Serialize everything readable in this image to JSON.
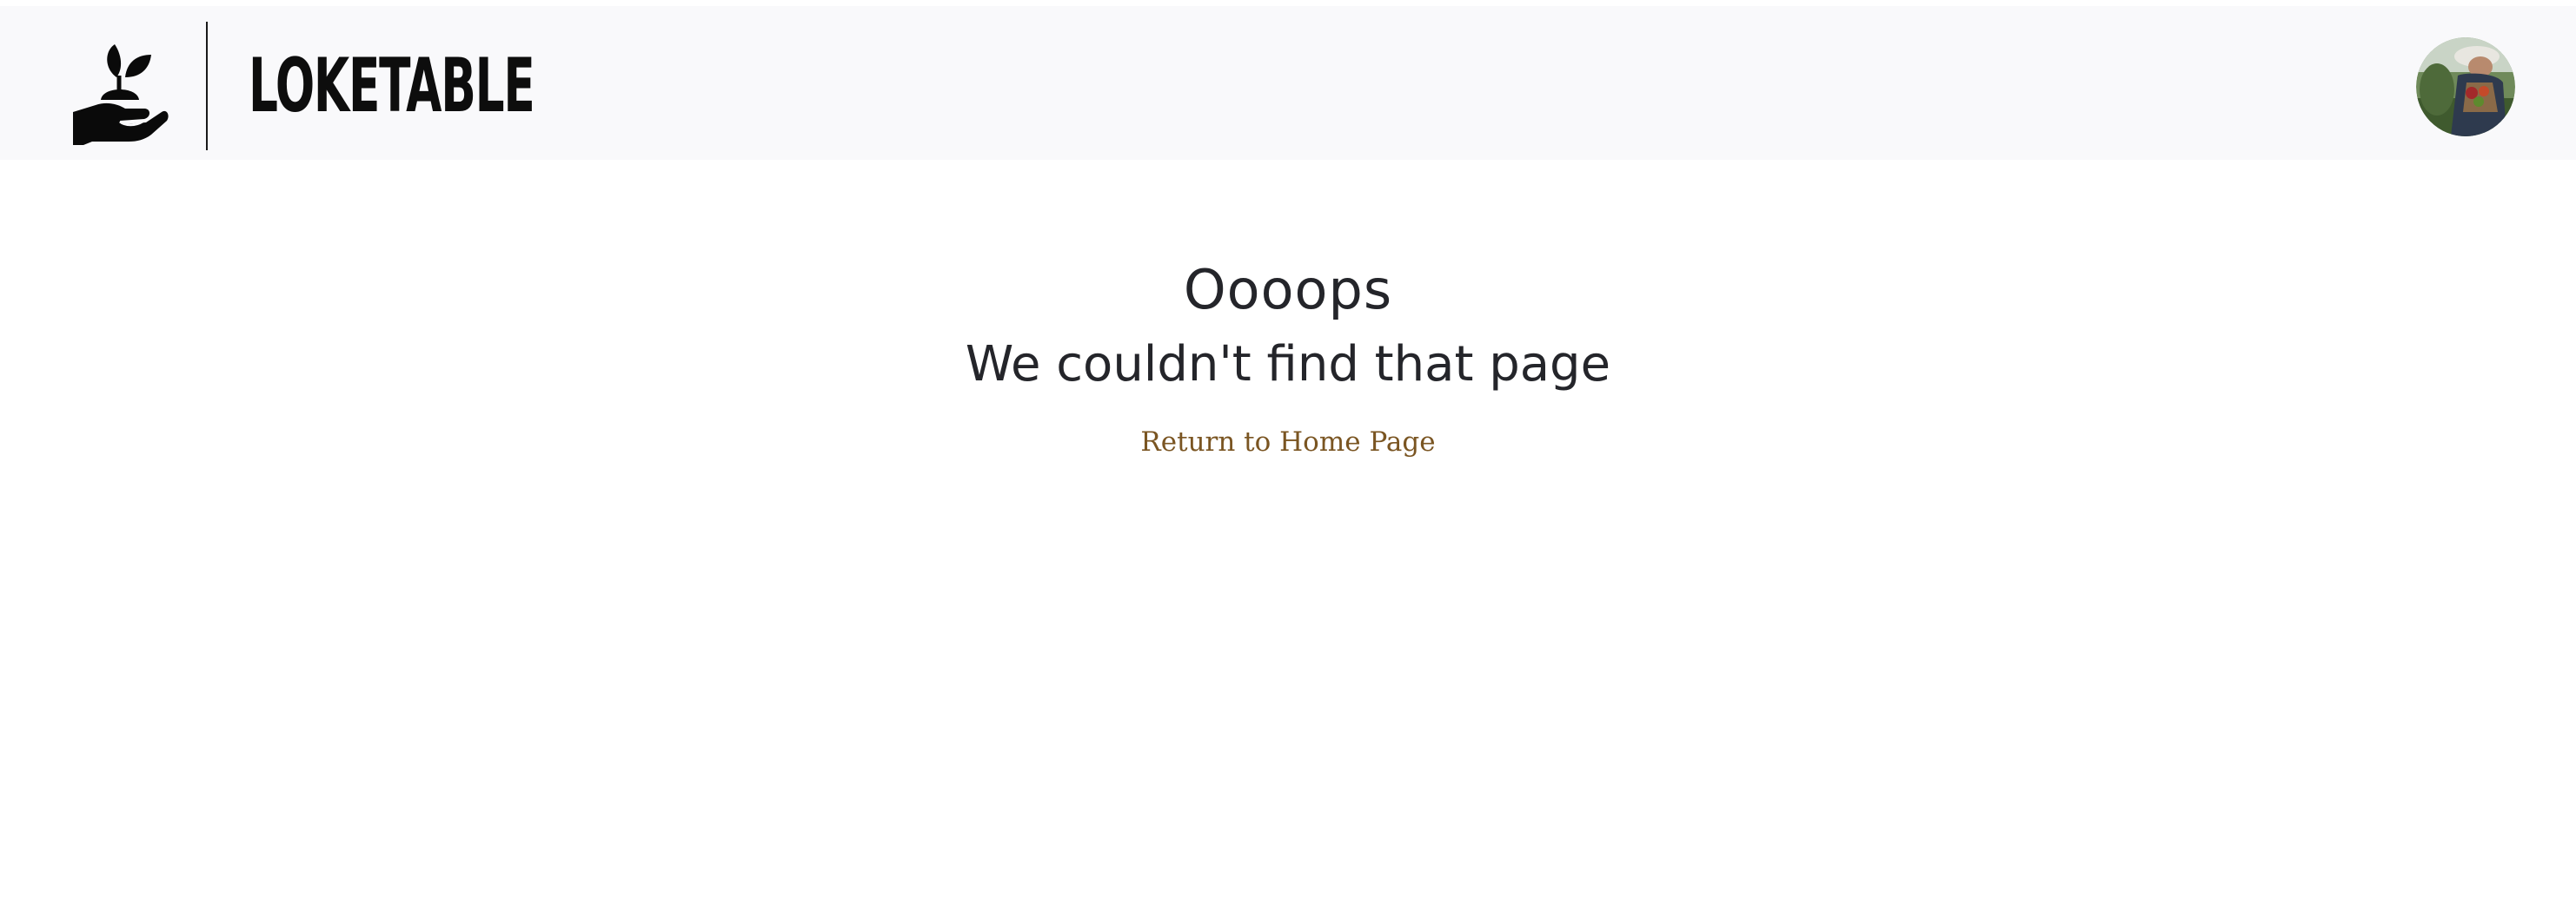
{
  "header": {
    "logo_icon": "hand-holding-seedling-icon",
    "brand_name": "LOKETABLE",
    "avatar_icon": "user-avatar-photo"
  },
  "main": {
    "title": "Oooops",
    "subtitle": "We couldn't find that page",
    "home_link_label": "Return to Home Page"
  },
  "colors": {
    "header_background": "#f9f9fb",
    "heading_text": "#24252a",
    "link_text": "#7a5522",
    "brand_text": "#0d0d0d"
  }
}
